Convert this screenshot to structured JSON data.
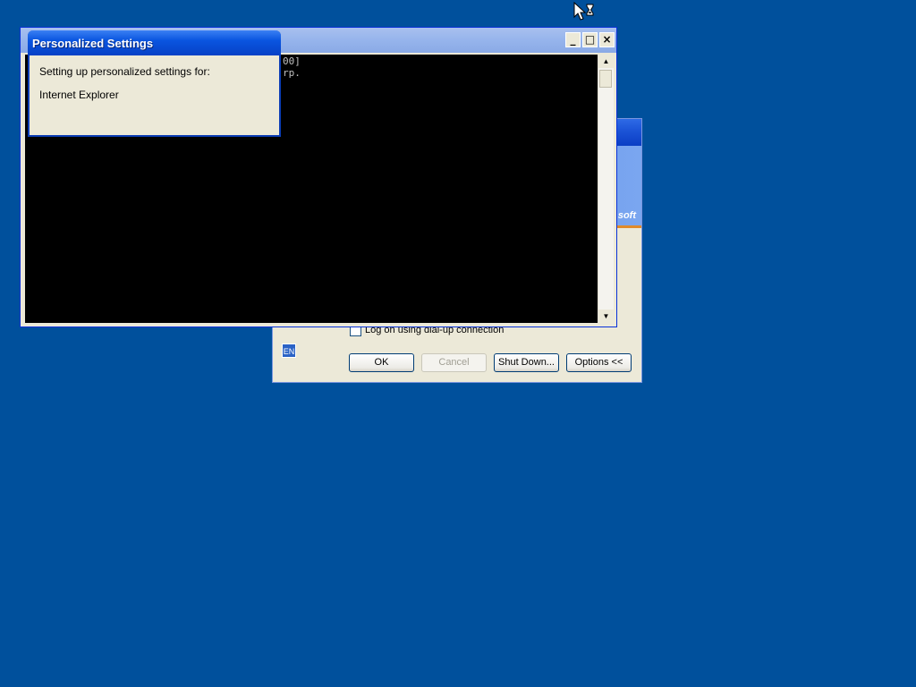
{
  "logon_dialog": {
    "brand_fragment": "soft",
    "dialup_label": "Log on using dial-up connection",
    "language_indicator": "EN",
    "buttons": {
      "ok": "OK",
      "cancel": "Cancel",
      "shutdown": "Shut Down...",
      "options": "Options <<"
    }
  },
  "console_window": {
    "title": "",
    "lines": [
      "00]",
      "rp."
    ],
    "caption_buttons": {
      "minimize": "_",
      "maximize": "□",
      "close": "×"
    }
  },
  "personalized_settings": {
    "title": "Personalized Settings",
    "message": "Setting up personalized settings for:",
    "component": "Internet Explorer"
  },
  "colors": {
    "desktop": "#00509c",
    "title_active": "#0a55e0",
    "title_inactive": "#96b4ec"
  },
  "cursor": {
    "type": "busy-arrow-icon"
  }
}
